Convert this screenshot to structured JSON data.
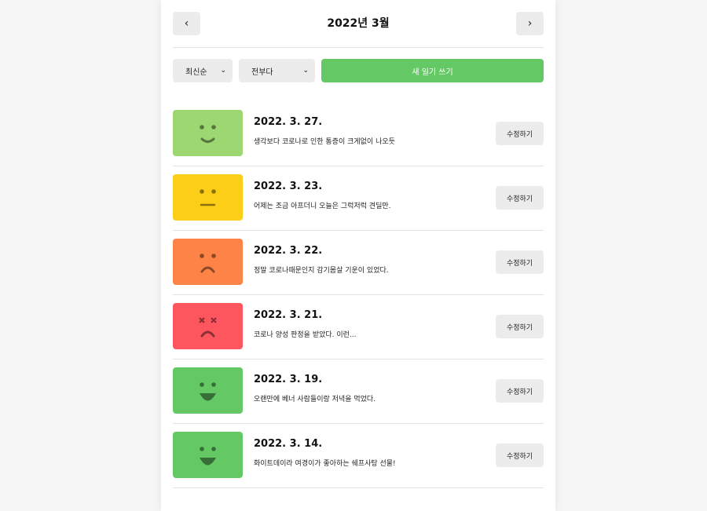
{
  "header": {
    "title": "2022년 3월",
    "prev_label": "‹",
    "next_label": "›"
  },
  "controls": {
    "sort_value": "최신순",
    "filter_value": "전부다",
    "new_button_label": "새 일기 쓰기",
    "chevron": "⌄"
  },
  "colors": {
    "accent_green": "#64c964",
    "emotion_1": "#64c964",
    "emotion_2": "#9dd772",
    "emotion_3": "#fdce17",
    "emotion_4": "#fd8446",
    "emotion_5": "#fd565f"
  },
  "diaries": [
    {
      "date": "2022. 3. 27.",
      "content": "생각보다 코로나로 인한 통증이 크게없이 나오듯",
      "emotion": "good-icon",
      "edit_label": "수정하기"
    },
    {
      "date": "2022. 3. 23.",
      "content": "어제는 조금 아프더니 오늘은 그럭저럭 견딜만.",
      "emotion": "neutral-icon",
      "edit_label": "수정하기"
    },
    {
      "date": "2022. 3. 22.",
      "content": "정말 코로나때문인지 감기몸살 기운이 있었다.",
      "emotion": "bad-icon",
      "edit_label": "수정하기"
    },
    {
      "date": "2022. 3. 21.",
      "content": "코로나 양성 판정을 받았다. 이런...",
      "emotion": "terrible-icon",
      "edit_label": "수정하기"
    },
    {
      "date": "2022. 3. 19.",
      "content": "오랜만에 베너 사람들이랑 저녁을 먹었다.",
      "emotion": "great-icon",
      "edit_label": "수정하기"
    },
    {
      "date": "2022. 3. 14.",
      "content": "화이트데이라 여경이가 좋아하는 쉐프사탕 선물!",
      "emotion": "great-icon",
      "edit_label": "수정하기"
    }
  ]
}
